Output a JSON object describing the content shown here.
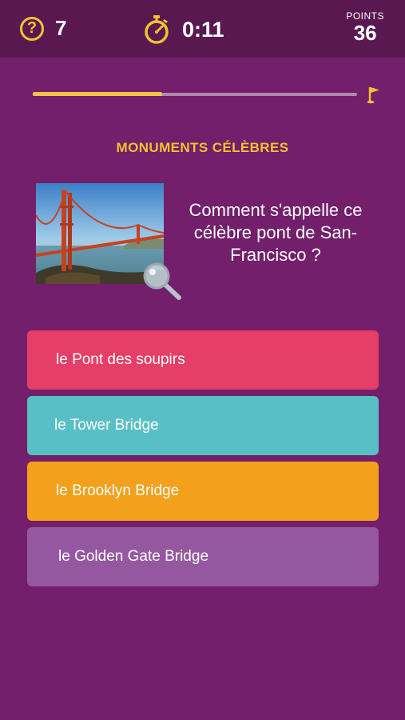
{
  "header": {
    "hints_count": "7",
    "timer": "0:11",
    "points_label": "POINTS",
    "points_value": "36"
  },
  "progress": {
    "fraction": 0.4
  },
  "quiz": {
    "category": "MONUMENTS CÉLÈBRES",
    "question": "Comment s'appelle ce célèbre pont de San-Francisco ?",
    "answers": [
      "le Pont des soupirs",
      "le Tower Bridge",
      "le Brooklyn Bridge",
      "le Golden Gate Bridge"
    ]
  },
  "colors": {
    "background": "#731f6b",
    "header_bar": "#5a1850",
    "accent_yellow": "#f2c230",
    "answer_1": "#e53e67",
    "answer_2": "#59bfc6",
    "answer_3": "#f3a01c",
    "answer_4": "#9558a0"
  },
  "icons": [
    "question-circle-icon",
    "stopwatch-icon",
    "goal-flag-icon",
    "magnifier-icon"
  ]
}
